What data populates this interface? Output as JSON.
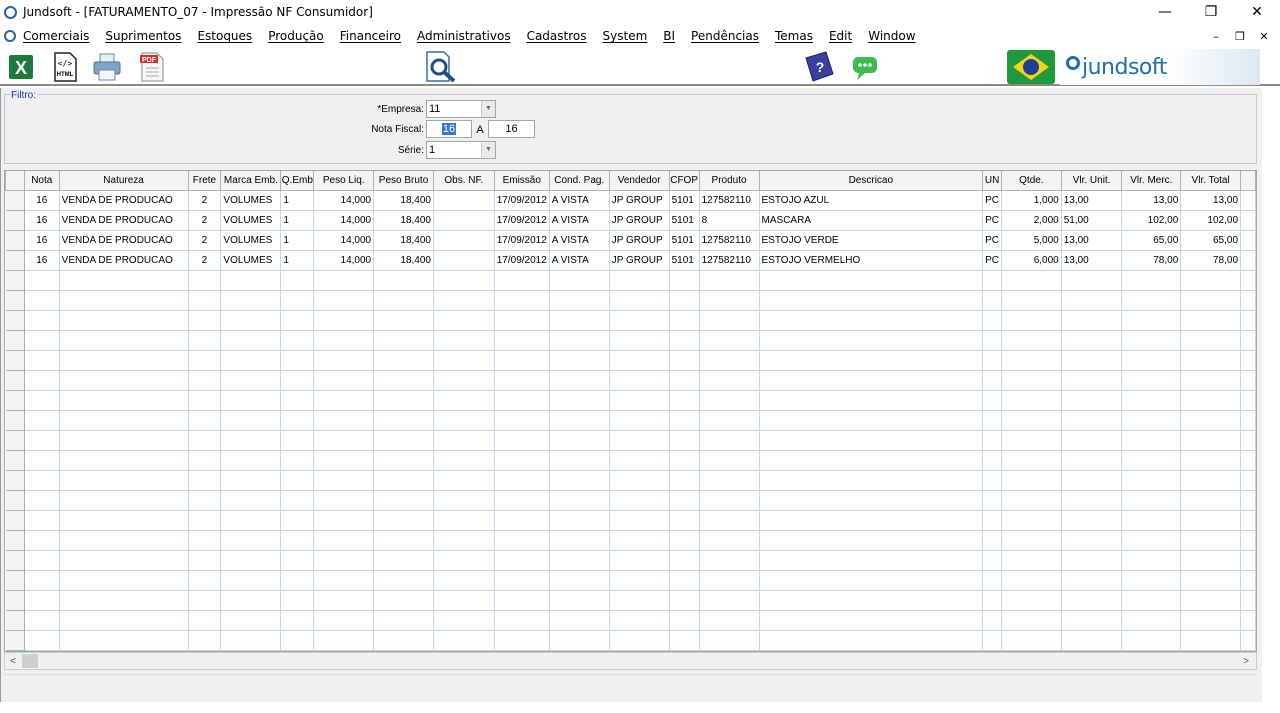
{
  "window": {
    "title": "Jundsoft - [FATURAMENTO_07 - Impressão NF Consumidor]",
    "minimize": "—",
    "restore": "❐",
    "close": "✕"
  },
  "menu": {
    "items": [
      "Comerciais",
      "Suprimentos",
      "Estoques",
      "Produção",
      "Financeiro",
      "Administrativos",
      "Cadastros",
      "System",
      "BI",
      "Pendências",
      "Temas",
      "Edit",
      "Window"
    ],
    "mdi_minimize": "–",
    "mdi_restore": "❐",
    "mdi_close": "✕"
  },
  "toolbar": {
    "excel": "X",
    "html": "HTML",
    "pdf": "PDF",
    "help": "?",
    "brand": "jundsoft"
  },
  "filter": {
    "legend": "Filtro:",
    "empresa_label": "*Empresa:",
    "empresa_value": "11",
    "nota_label": "Nota Fiscal:",
    "nota_from": "16",
    "nota_sep": "A",
    "nota_to": "16",
    "serie_label": "Série:",
    "serie_value": "1"
  },
  "table": {
    "columns": [
      "Nota",
      "Natureza",
      "Frete",
      "Marca Emb.",
      "Q.Emb",
      "Peso Liq.",
      "Peso Bruto",
      "Obs. NF.",
      "Emissão",
      "Cond. Pag.",
      "Vendedor",
      "CFOP",
      "Produto",
      "Descricao",
      "UN",
      "Qtde.",
      "Vlr. Unit.",
      "Vlr. Merc.",
      "Vlr. Total"
    ],
    "rows": [
      [
        "16",
        "VENDA DE PRODUCAO",
        "2",
        "VOLUMES",
        "1",
        "14,000",
        "18,400",
        "",
        "17/09/2012",
        "A VISTA",
        "JP GROUP",
        "5101",
        "127582110",
        "ESTOJO AZUL",
        "PC",
        "1,000",
        "13,00",
        "13,00",
        "13,00"
      ],
      [
        "16",
        "VENDA DE PRODUCAO",
        "2",
        "VOLUMES",
        "1",
        "14,000",
        "18,400",
        "",
        "17/09/2012",
        "A VISTA",
        "JP GROUP",
        "5101",
        "8",
        "MASCARA",
        "PC",
        "2,000",
        "51,00",
        "102,00",
        "102,00"
      ],
      [
        "16",
        "VENDA DE PRODUCAO",
        "2",
        "VOLUMES",
        "1",
        "14,000",
        "18,400",
        "",
        "17/09/2012",
        "A VISTA",
        "JP GROUP",
        "5101",
        "127582110",
        "ESTOJO VERDE",
        "PC",
        "5,000",
        "13,00",
        "65,00",
        "65,00"
      ],
      [
        "16",
        "VENDA DE PRODUCAO",
        "2",
        "VOLUMES",
        "1",
        "14,000",
        "18,400",
        "",
        "17/09/2012",
        "A VISTA",
        "JP GROUP",
        "5101",
        "127582110",
        "ESTOJO VERMELHO",
        "PC",
        "6,000",
        "13,00",
        "78,00",
        "78,00"
      ]
    ]
  },
  "scroll": {
    "left": "<",
    "right": ">"
  },
  "colors": {
    "accent": "#1e6fb0",
    "filter_legend": "#1a3aa0",
    "grid_line": "#c8d4ee"
  }
}
